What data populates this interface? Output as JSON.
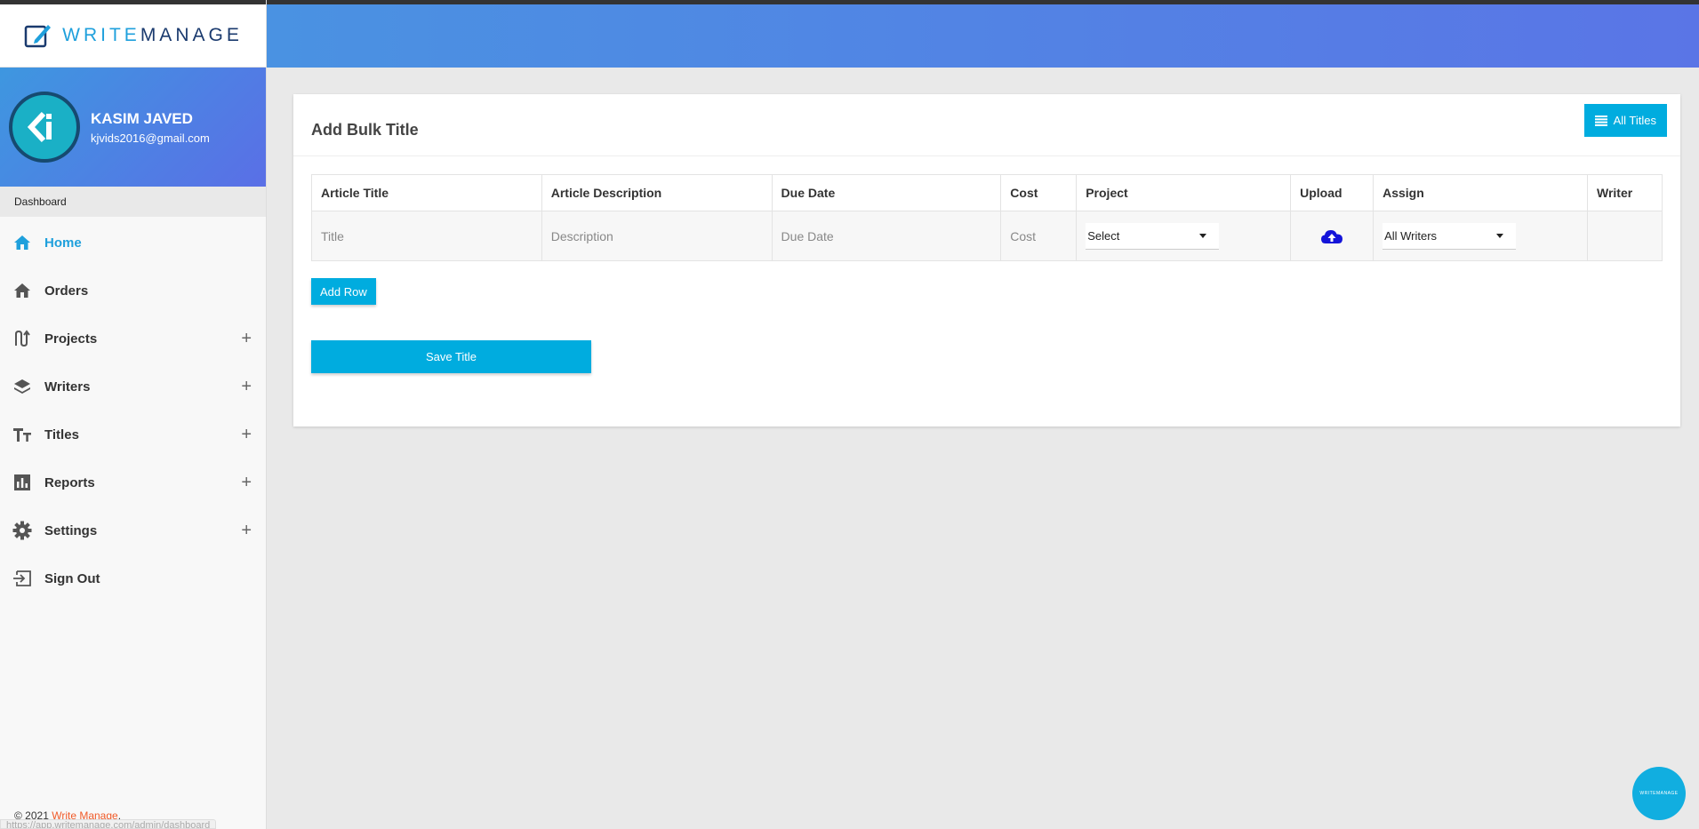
{
  "brand": {
    "logo_part1": "WRITE",
    "logo_part2": "MANAGE"
  },
  "user": {
    "name": "KASIM JAVED",
    "email": "kjvids2016@gmail.com"
  },
  "sidebar": {
    "section_label": "Dashboard",
    "items": [
      {
        "label": "Home",
        "icon": "home-icon",
        "active": true
      },
      {
        "label": "Orders",
        "icon": "home-icon"
      },
      {
        "label": "Projects",
        "icon": "route-icon",
        "expandable": true
      },
      {
        "label": "Writers",
        "icon": "layers-icon",
        "expandable": true
      },
      {
        "label": "Titles",
        "icon": "text-size-icon",
        "expandable": true
      },
      {
        "label": "Reports",
        "icon": "bar-chart-icon",
        "expandable": true
      },
      {
        "label": "Settings",
        "icon": "gear-icon",
        "expandable": true
      },
      {
        "label": "Sign Out",
        "icon": "sign-out-icon"
      }
    ],
    "expand_symbol": "+",
    "footer_copyright": "© 2021 ",
    "footer_brand": "Write Manage",
    "footer_period": ".",
    "status_url": "https://app.writemanage.com/admin/dashboard"
  },
  "card": {
    "title": "Add Bulk Title",
    "all_titles_button": "All Titles",
    "table": {
      "headers": [
        "Article Title",
        "Article Description",
        "Due Date",
        "Cost",
        "Project",
        "Upload",
        "Assign",
        "Writer"
      ],
      "row": {
        "title_placeholder": "Title",
        "description_placeholder": "Description",
        "due_date_placeholder": "Due Date",
        "cost_placeholder": "Cost",
        "project_select": "Select",
        "assign_select": "All Writers"
      }
    },
    "add_row_button": "Add Row",
    "save_button": "Save Title"
  },
  "colors": {
    "accent": "#00acdf",
    "brand_orange": "#f05a28",
    "upload_icon": "#1414d9"
  }
}
